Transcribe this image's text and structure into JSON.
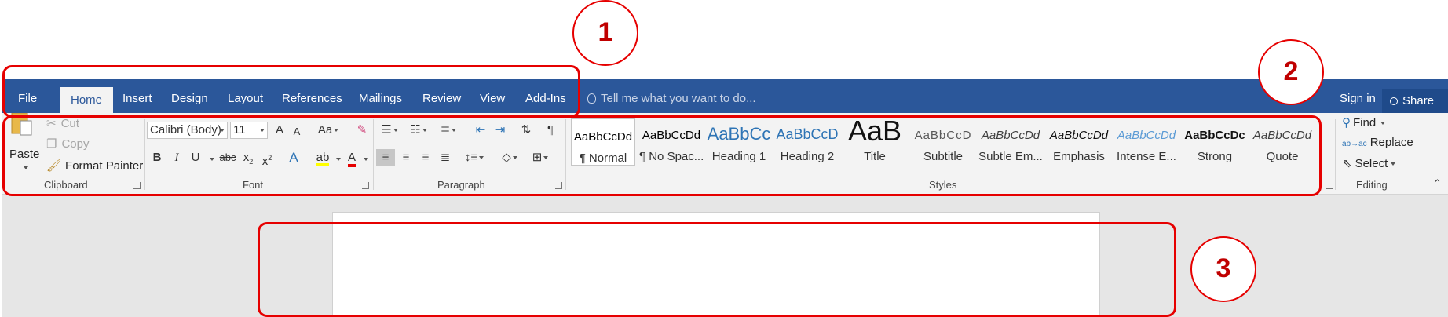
{
  "tabs": [
    "File",
    "Home",
    "Insert",
    "Design",
    "Layout",
    "References",
    "Mailings",
    "Review",
    "View",
    "Add-Ins"
  ],
  "active_tab": "Home",
  "tell_me": "Tell me what you want to do...",
  "sign_in": "Sign in",
  "share": "Share",
  "clipboard": {
    "paste": "Paste",
    "cut": "Cut",
    "copy": "Copy",
    "format_painter": "Format Painter",
    "label": "Clipboard"
  },
  "font": {
    "name": "Calibri (Body)",
    "size": "11",
    "grow": "A",
    "shrink": "A",
    "case": "Aa",
    "bold": "B",
    "italic": "I",
    "underline": "U",
    "strike": "abc",
    "subscript": "x",
    "superscript": "x",
    "sub_digit": "2",
    "sup_digit": "2",
    "label": "Font"
  },
  "paragraph": {
    "label": "Paragraph"
  },
  "styles": {
    "label": "Styles",
    "items": [
      {
        "sample": "AaBbCcDd",
        "name": "¶ Normal"
      },
      {
        "sample": "AaBbCcDd",
        "name": "¶ No Spac..."
      },
      {
        "sample": "AaBbCc",
        "name": "Heading 1"
      },
      {
        "sample": "AaBbCcD",
        "name": "Heading 2"
      },
      {
        "sample": "AaB",
        "name": "Title"
      },
      {
        "sample": "AaBbCcD",
        "name": "Subtitle"
      },
      {
        "sample": "AaBbCcDd",
        "name": "Subtle Em..."
      },
      {
        "sample": "AaBbCcDd",
        "name": "Emphasis"
      },
      {
        "sample": "AaBbCcDd",
        "name": "Intense E..."
      },
      {
        "sample": "AaBbCcDc",
        "name": "Strong"
      },
      {
        "sample": "AaBbCcDd",
        "name": "Quote"
      }
    ]
  },
  "editing": {
    "find": "Find",
    "replace": "Replace",
    "select": "Select",
    "label": "Editing"
  },
  "callouts": [
    "1",
    "2",
    "3"
  ],
  "colors": {
    "ribbon_blue": "#2b579a",
    "annotation_red": "#e60000",
    "heading_blue": "#2e74b5"
  }
}
